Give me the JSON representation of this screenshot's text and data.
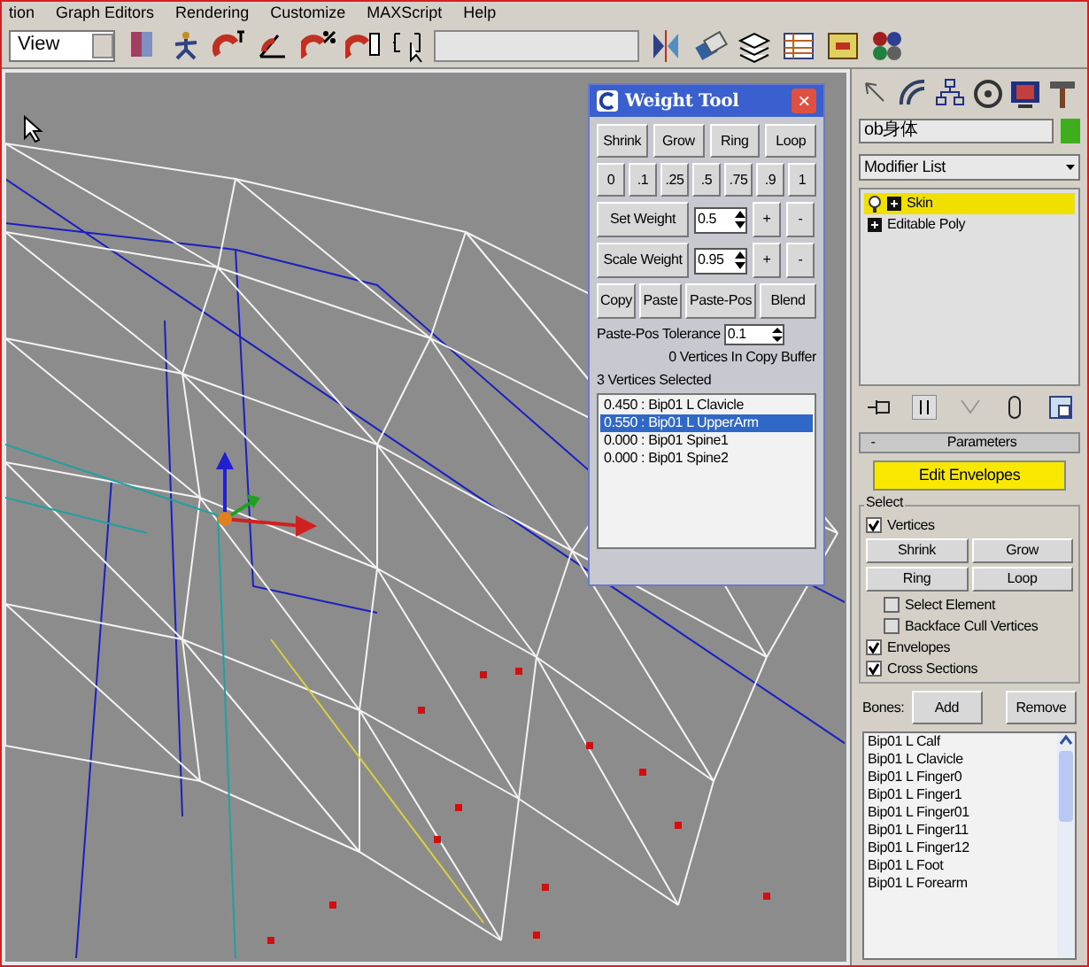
{
  "menu_bar": {
    "items": [
      "tion",
      "Graph Editors",
      "Rendering",
      "Customize",
      "MAXScript",
      "Help"
    ]
  },
  "toolbar": {
    "view_dropdown": "View"
  },
  "weight_tool": {
    "title": "Weight Tool",
    "close": "×",
    "select_buttons": [
      "Shrink",
      "Grow",
      "Ring",
      "Loop"
    ],
    "preset_buttons": [
      "0",
      ".1",
      ".25",
      ".5",
      ".75",
      ".9",
      "1"
    ],
    "weight_rows": [
      {
        "label": "Set Weight",
        "value": "0.5",
        "plus": "+",
        "minus": "-"
      },
      {
        "label": "Scale Weight",
        "value": "0.95",
        "plus": "+",
        "minus": "-"
      }
    ],
    "copy_buttons": [
      "Copy",
      "Paste",
      "Paste-Pos",
      "Blend"
    ],
    "tolerance": {
      "label": "Paste-Pos Tolerance",
      "value": "0.1"
    },
    "copy_buffer": "0 Vertices In Copy Buffer",
    "selected_count": "3 Vertices Selected",
    "weights": [
      {
        "text": "0.450 : Bip01 L Clavicle",
        "selected": false
      },
      {
        "text": "0.550 : Bip01 L UpperArm",
        "selected": true
      },
      {
        "text": "0.000 : Bip01 Spine1",
        "selected": false
      },
      {
        "text": "0.000 : Bip01 Spine2",
        "selected": false
      }
    ]
  },
  "command_panel": {
    "object_name": "ob身体",
    "modifier_list": "Modifier List",
    "stack": [
      {
        "label": "Skin",
        "selected": true
      },
      {
        "label": "Editable Poly",
        "selected": false
      }
    ],
    "parameters": {
      "collapse": "-",
      "title": "Parameters",
      "edit_envelopes": {
        "label": "Edit Envelopes",
        "on": true
      },
      "select": {
        "title": "Select",
        "vertices": {
          "label": "Vertices",
          "checked": true
        },
        "buttons": [
          "Shrink",
          "Grow",
          "Ring",
          "Loop"
        ],
        "sub_options": [
          {
            "label": "Select Element",
            "checked": false
          },
          {
            "label": "Backface Cull Vertices",
            "checked": false
          }
        ],
        "options": [
          {
            "label": "Envelopes",
            "checked": true
          },
          {
            "label": "Cross Sections",
            "checked": true
          }
        ]
      },
      "bones": {
        "label": "Bones:",
        "buttons": [
          "Add",
          "Remove"
        ],
        "items": [
          "Bip01 L Calf",
          "Bip01 L Clavicle",
          "Bip01 L Finger0",
          "Bip01 L Finger1",
          "Bip01 L Finger01",
          "Bip01 L Finger11",
          "Bip01 L Finger12",
          "Bip01 L Foot",
          "Bip01 L Forearm"
        ]
      }
    }
  }
}
